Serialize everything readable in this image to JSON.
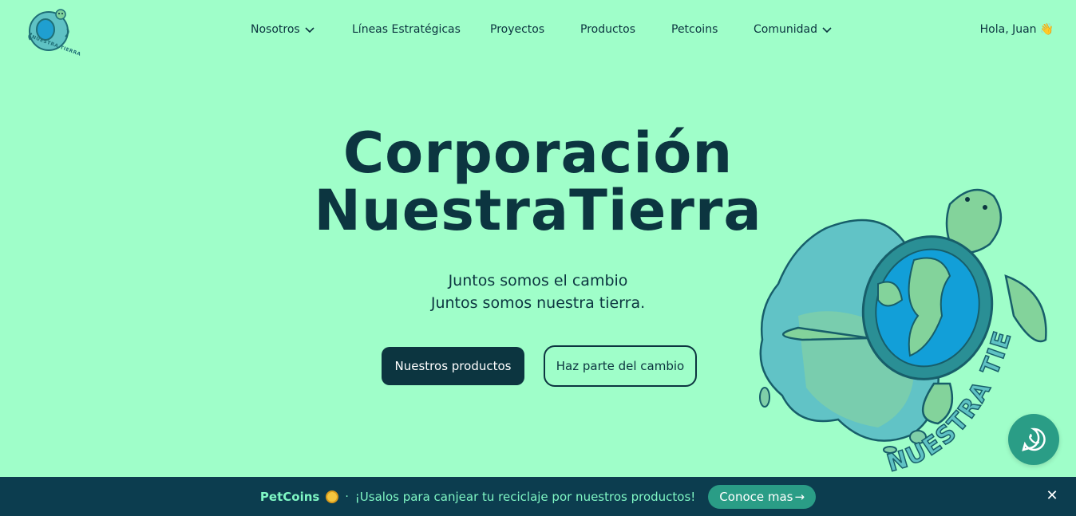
{
  "header": {
    "logo_text": "NUESTRA TIERRA",
    "nav": [
      {
        "label": "Nosotros",
        "has_dropdown": true
      },
      {
        "label": "Líneas Estratégicas",
        "has_dropdown": false
      },
      {
        "label": "Proyectos",
        "has_dropdown": false
      },
      {
        "label": "Productos",
        "has_dropdown": false
      },
      {
        "label": "Petcoins",
        "has_dropdown": false
      },
      {
        "label": "Comunidad",
        "has_dropdown": true
      }
    ],
    "greeting": "Hola, Juan",
    "greeting_emoji": "👋"
  },
  "hero": {
    "title_line1": "Corporación",
    "title_line2": "NuestraTierra",
    "subtitle_line1": "Juntos somos el cambio",
    "subtitle_line2": "Juntos somos nuestra tierra.",
    "primary_button": "Nuestros productos",
    "secondary_button": "Haz parte del cambio",
    "illustration_text": "NUESTRA TIERRA"
  },
  "banner": {
    "brand": "PetCoins",
    "separator": "·",
    "message": "¡Usalos para canjear tu reciclaje por nuestros productos!",
    "cta": "Conoce mas",
    "cta_arrow": "→",
    "close": "✕"
  },
  "icons": {
    "dropdown": "chevron-down-icon",
    "whatsapp": "whatsapp-icon",
    "coin": "coin-icon",
    "close": "close-icon"
  },
  "colors": {
    "background": "#9ffec9",
    "primary": "#0c3540",
    "banner": "#0c3d4f",
    "accent": "#2a9d86",
    "banner_text": "#7ff7c4"
  }
}
